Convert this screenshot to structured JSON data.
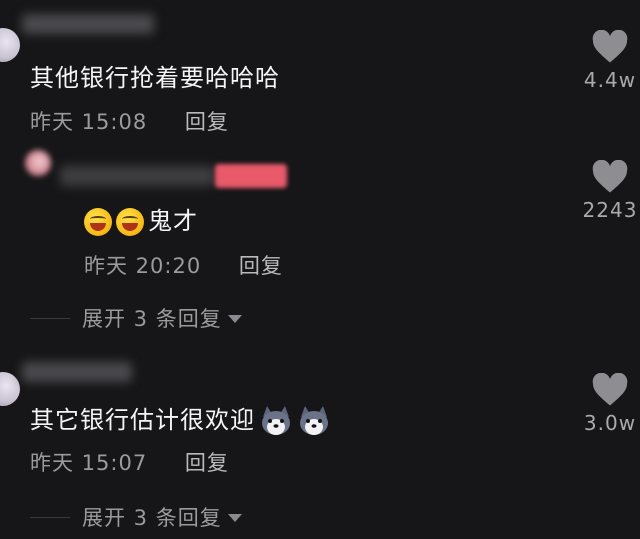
{
  "comments": [
    {
      "text": "其他银行抢着要哈哈哈",
      "time": "昨天 15:08",
      "reply_label": "回复",
      "likes": "4.4w"
    },
    {
      "text": "鬼才",
      "emoji": "laughing-crying-emoji",
      "time": "昨天 20:20",
      "reply_label": "回复",
      "likes": "2243",
      "expand_label": "展开 3 条回复"
    },
    {
      "text": "其它银行估计很欢迎",
      "emoji": "husky-dog-emoji",
      "time": "昨天 15:07",
      "reply_label": "回复",
      "likes": "3.0w",
      "expand_label": "展开 3 条回复"
    }
  ],
  "colors": {
    "background": "#161618",
    "text": "#f4f4f4",
    "meta": "#9a9a9f",
    "blur_accent": "#e85a6a"
  }
}
